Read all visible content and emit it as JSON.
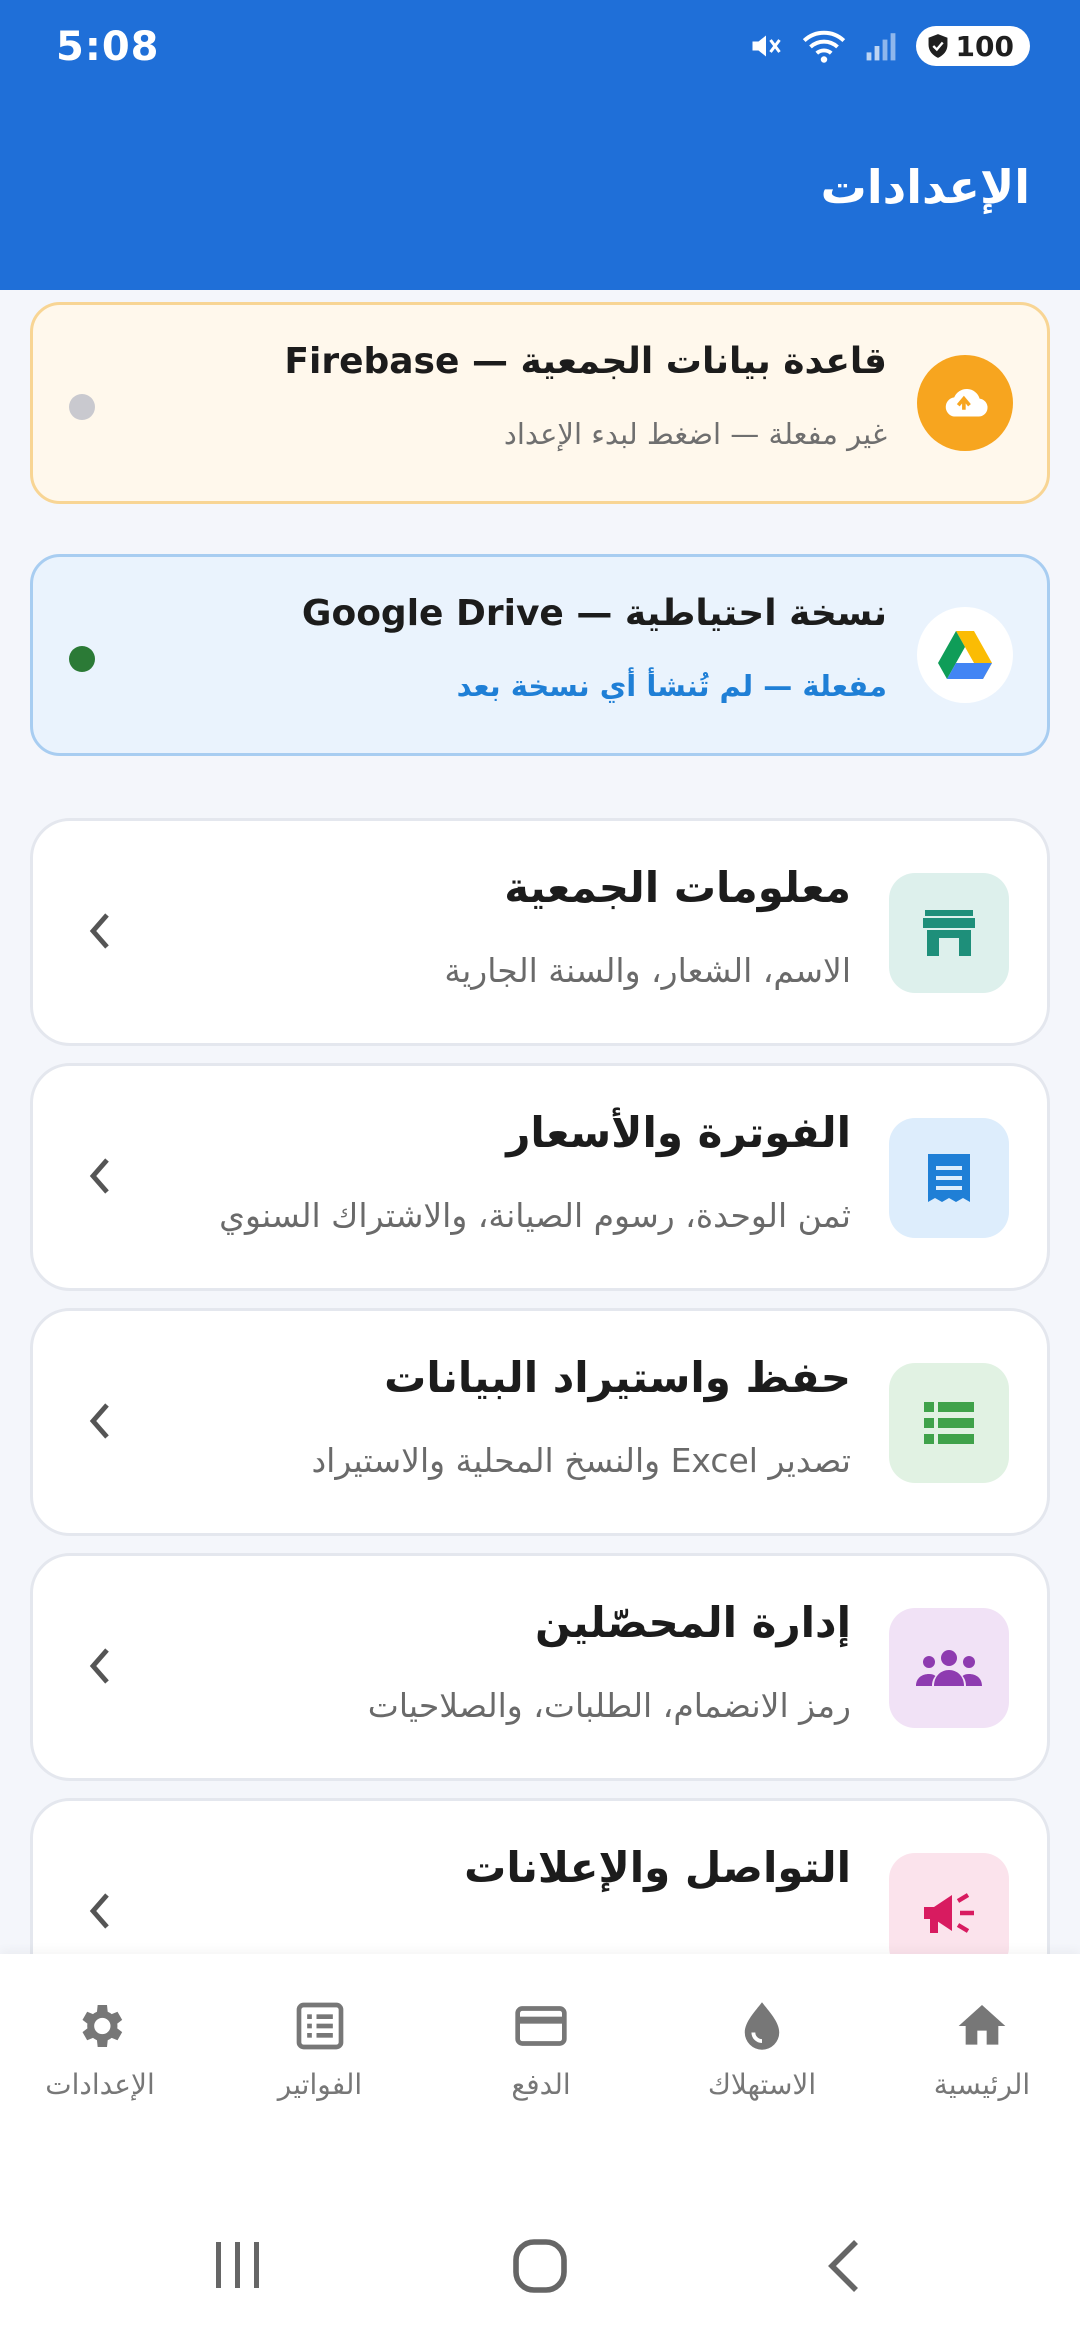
{
  "status_bar": {
    "time": "5:08",
    "battery": "100"
  },
  "header": {
    "title": "الإعدادات"
  },
  "firebase_card": {
    "icon": "cloud-sync-icon",
    "title": "قاعدة بيانات الجمعية — Firebase",
    "subtitle": "غير مفعلة — اضغط لبدء الإعداد",
    "status_color": "#c9c9cf"
  },
  "drive_card": {
    "icon": "google-drive-icon",
    "title": "نسخة احتياطية — Google Drive",
    "subtitle": "مفعلة — لم تُنشأ أي نسخة بعد",
    "status_color": "#2b7a36"
  },
  "menu": [
    {
      "title": "معلومات الجمعية",
      "subtitle": "الاسم، الشعار، والسنة الجارية",
      "icon": "store-icon",
      "color": "#1e8f7a"
    },
    {
      "title": "الفوترة والأسعار",
      "subtitle": "ثمن الوحدة، رسوم الصيانة، والاشتراك السنوي",
      "icon": "receipt-icon",
      "color": "#1f7fd6"
    },
    {
      "title": "حفظ واستيراد البيانات",
      "subtitle": "تصدير Excel والنسخ المحلية والاستيراد",
      "icon": "table-icon",
      "color": "#3fa24a"
    },
    {
      "title": "إدارة المحصّلين",
      "subtitle": "رمز الانضمام، الطلبات، والصلاحيات",
      "icon": "group-icon",
      "color": "#8e3bb0"
    },
    {
      "title": "التواصل والإعلانات",
      "subtitle": "",
      "icon": "megaphone-icon",
      "color": "#d81b60"
    }
  ],
  "bottom_nav": [
    {
      "label": "الإعدادات",
      "icon": "settings-icon"
    },
    {
      "label": "الفواتير",
      "icon": "list-icon"
    },
    {
      "label": "الدفع",
      "icon": "card-icon"
    },
    {
      "label": "الاستهلاك",
      "icon": "drop-icon"
    },
    {
      "label": "الرئيسية",
      "icon": "home-icon"
    }
  ]
}
